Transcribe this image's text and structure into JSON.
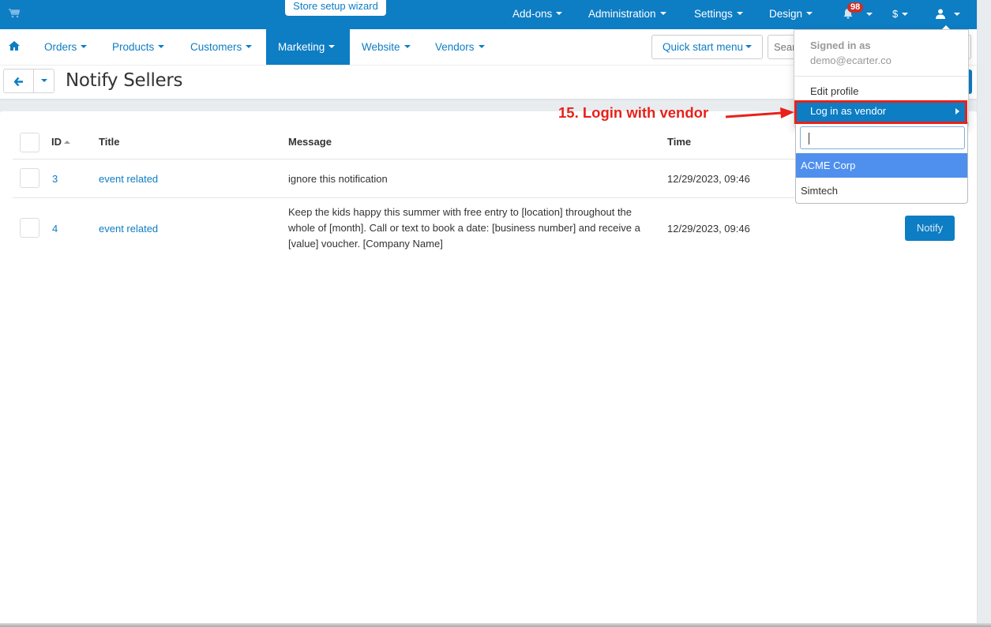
{
  "topbar": {
    "cart_icon": "shopping-cart-icon",
    "wizard_label": "Store setup wizard",
    "menus": [
      {
        "label": "Add-ons"
      },
      {
        "label": "Administration"
      },
      {
        "label": "Settings"
      },
      {
        "label": "Design"
      }
    ],
    "notifications_count": "98",
    "currency_label": "$",
    "user_icon": "user-icon"
  },
  "nav": {
    "home_icon": "home-icon",
    "items": [
      {
        "label": "Orders"
      },
      {
        "label": "Products"
      },
      {
        "label": "Customers"
      },
      {
        "label": "Marketing",
        "active": true
      },
      {
        "label": "Website"
      },
      {
        "label": "Vendors"
      }
    ],
    "quick_start_label": "Quick start menu",
    "search_placeholder": "Search"
  },
  "page": {
    "title": "Notify Sellers"
  },
  "table": {
    "columns": [
      "ID",
      "Title",
      "Message",
      "Time"
    ],
    "rows": [
      {
        "id": "3",
        "title": "event related",
        "message": "ignore this notification",
        "time": "12/29/2023, 09:46",
        "action": ""
      },
      {
        "id": "4",
        "title": "event related",
        "message": "Keep the kids happy this summer with free entry to [location] throughout the whole of [month]. Call or text to book a date: [business number] and receive a [value] voucher. [Company Name]",
        "time": "12/29/2023, 09:46",
        "action": "Notify"
      }
    ]
  },
  "user_dropdown": {
    "signed_in_label": "Signed in as",
    "email": "demo@ecarter.co",
    "edit_profile": "Edit profile",
    "login_as_vendor": "Log in as vendor",
    "vendor_search_value": "",
    "vendors": [
      {
        "name": "ACME Corp",
        "highlighted": true
      },
      {
        "name": "Simtech",
        "highlighted": false
      }
    ]
  },
  "annotation": {
    "text": "15. Login with vendor",
    "color": "#e8211a"
  },
  "colors": {
    "brand": "#0d7dc4",
    "highlight": "#4f8fee",
    "badge": "#c9302c"
  }
}
